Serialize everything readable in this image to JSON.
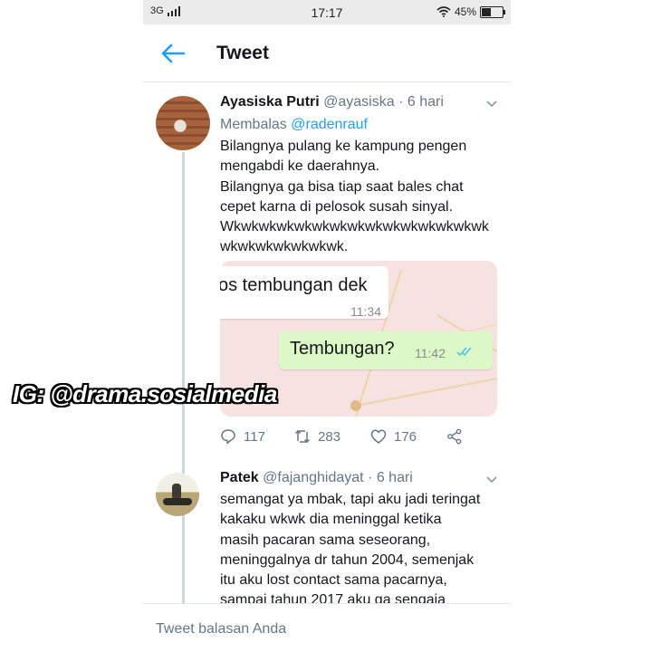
{
  "status_bar": {
    "network": "3G",
    "time": "17:17",
    "battery": "45%"
  },
  "header": {
    "title": "Tweet",
    "back_icon": "arrow-left-icon"
  },
  "tweets": [
    {
      "name": "Ayasiska Putri",
      "handle": "@ayasiska",
      "time": "· 6 hari",
      "reply_prefix": "Membalas ",
      "reply_to": "@radenrauf",
      "lines": [
        "Bilangnya pulang ke kampung pengen",
        "mengabdi ke daerahnya.",
        "Bilangnya ga bisa tiap saat bales chat",
        "cepet karna di pelosok susah sinyal.",
        "Wkwkwkwkwkwkwkwkwkwkwkwkwkwkwk",
        "wkwkwkwkwkwkwk."
      ],
      "media": {
        "incoming_text": "os tembungan dek",
        "incoming_time": "11:34",
        "outgoing_text": "Tembungan?",
        "outgoing_time": "11:42"
      },
      "actions": {
        "replies": "117",
        "retweets": "283",
        "likes": "176"
      }
    },
    {
      "name": "Patek",
      "handle": "@fajanghidayat",
      "time": "· 6 hari",
      "lines": [
        "semangat ya mbak, tapi aku jadi teringat",
        "kakaku wkwk dia meninggal ketika",
        "masih pacaran sama seseorang,",
        "meninggalnya dr tahun 2004, semenjak",
        "itu aku lost contact sama pacarnya,",
        "sampai tahun 2017 aku ga sengaja"
      ]
    }
  ],
  "watermark": "IG: @drama.sosialmedia",
  "composer": {
    "placeholder": "Tweet balasan Anda"
  },
  "colors": {
    "accent": "#1da1f2",
    "secondary_text": "#657786",
    "divider": "#e1e8ed",
    "whatsapp_out": "#dcf8c6"
  }
}
